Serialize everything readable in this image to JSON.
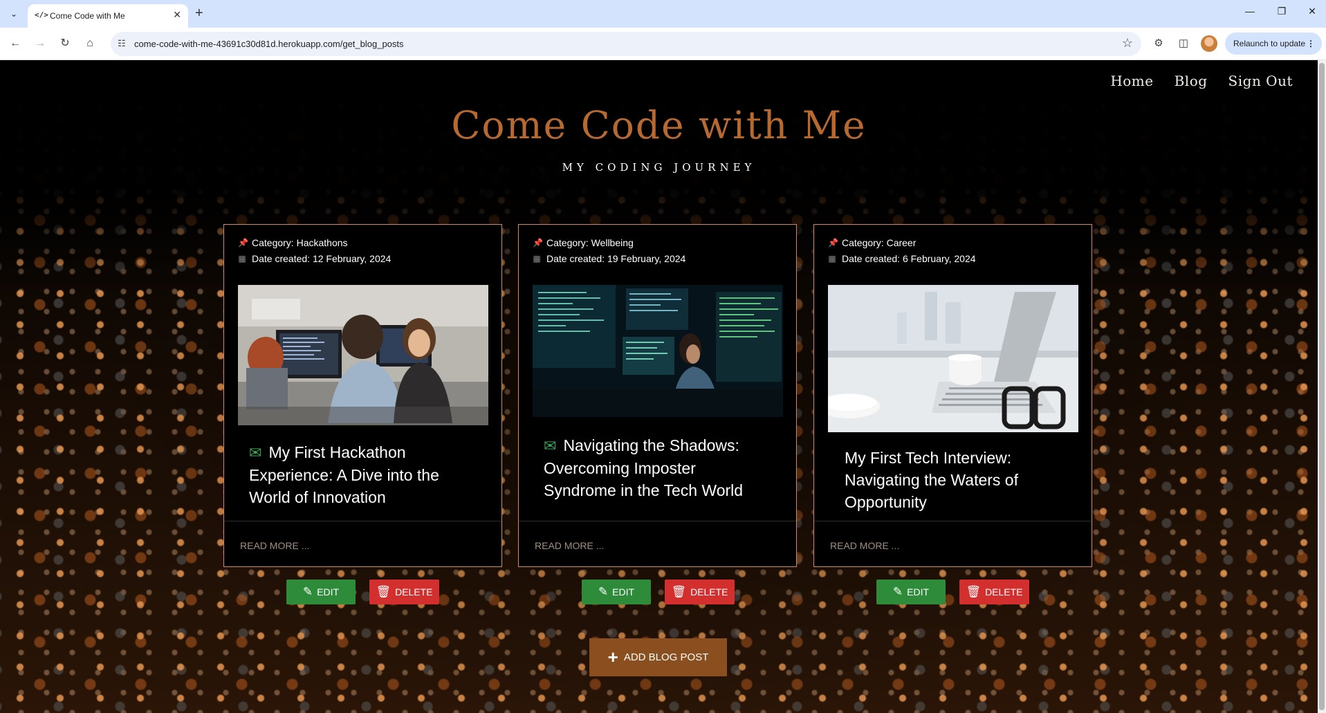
{
  "browser": {
    "tab_title": "Come Code with Me",
    "tab_favicon": "</>",
    "url": "come-code-with-me-43691c30d81d.herokuapp.com/get_blog_posts",
    "relaunch_label": "Relaunch to update",
    "icons": [
      "tab-list-icon",
      "close-icon",
      "new-tab-icon",
      "minimize-icon",
      "restore-icon",
      "close-window-icon",
      "back-icon",
      "forward-icon",
      "reload-icon",
      "home-icon",
      "site-info-icon",
      "bookmark-star-icon",
      "extensions-icon",
      "side-panel-icon",
      "profile-avatar",
      "more-icon"
    ]
  },
  "nav": {
    "home": "Home",
    "blog": "Blog",
    "sign_out": "Sign Out"
  },
  "header": {
    "title": "Come Code with Me",
    "subtitle": "MY CODING JOURNEY"
  },
  "posts": [
    {
      "category": "Category: Hackathons",
      "date": "Date created: 12 February, 2024",
      "title": "My First Hackathon Experience: A Dive into the World of Innovation",
      "read_more": "READ MORE ...",
      "edit_label": "EDIT",
      "delete_label": "DELETE",
      "image": "people-at-computers-photo"
    },
    {
      "category": "Category: Wellbeing",
      "date": "Date created: 19 February, 2024",
      "title": "Navigating the Shadows: Overcoming Imposter Syndrome in the Tech World",
      "read_more": "READ MORE ...",
      "edit_label": "EDIT",
      "delete_label": "DELETE",
      "image": "woman-coding-dark-room-photo"
    },
    {
      "category": "Category: Career",
      "date": "Date created: 6 February, 2024",
      "title": "My First Tech Interview: Navigating the Waters of Opportunity",
      "read_more": "READ MORE ...",
      "edit_label": "EDIT",
      "delete_label": "DELETE",
      "image": "laptop-glasses-coffee-photo"
    }
  ],
  "add_post_label": "ADD BLOG POST",
  "colors": {
    "accent": "#b8692f",
    "card_border": "#d38a5a",
    "edit_green": "#2e8b3a",
    "delete_red": "#d32f2f",
    "add_brown": "#8b4f1f",
    "envelope_green": "#3aa45a"
  }
}
